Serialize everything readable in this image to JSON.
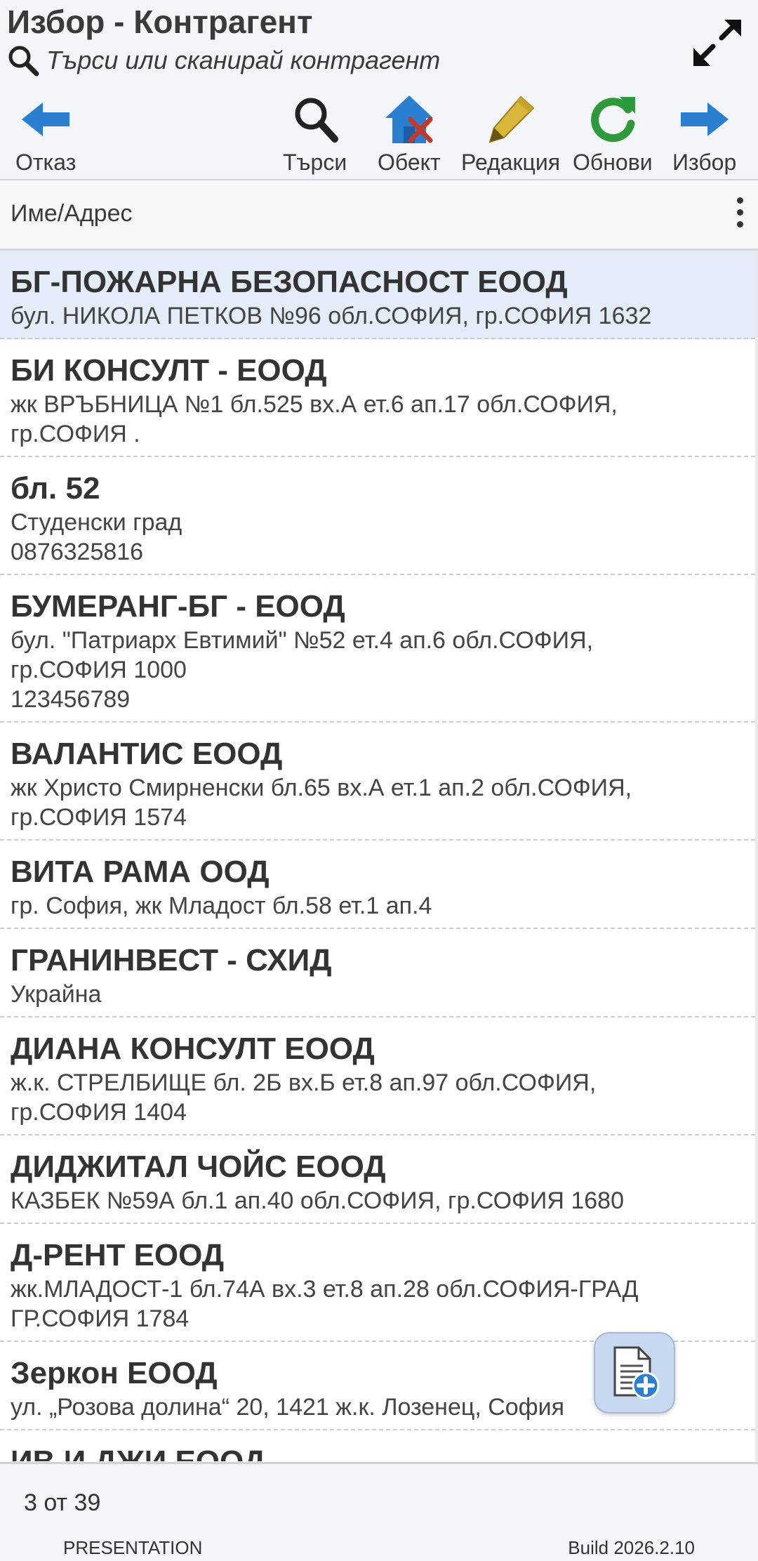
{
  "header": {
    "title": "Избор - Контрагент",
    "search_placeholder": "Търси или сканирай контрагент"
  },
  "toolbar": {
    "cancel": "Отказ",
    "search": "Търси",
    "object": "Обект",
    "edit": "Редакция",
    "refresh": "Обнови",
    "select": "Избор"
  },
  "list_header": {
    "column": "Име/Адрес"
  },
  "items": [
    {
      "name": "БГ-ПОЖАРНА БЕЗОПАСНОСТ ЕООД",
      "lines": [
        "бул. НИКОЛА ПЕТКОВ №96 обл.СОФИЯ, гр.СОФИЯ 1632"
      ]
    },
    {
      "name": "БИ КОНСУЛТ - ЕООД",
      "lines": [
        "жк ВРЪБНИЦА №1 бл.525 вх.А ет.6 ап.17 обл.СОФИЯ,",
        "гр.СОФИЯ ."
      ]
    },
    {
      "name": "бл. 52",
      "lines": [
        "Студенски град",
        "0876325816"
      ]
    },
    {
      "name": "БУМЕРАНГ-БГ - ЕООД",
      "lines": [
        "бул. \"Патриарх Евтимий\" №52 ет.4 ап.6 обл.СОФИЯ,",
        "гр.СОФИЯ 1000",
        "123456789"
      ]
    },
    {
      "name": "ВАЛАНТИС ЕООД",
      "lines": [
        "жк Христо Смирненски бл.65 вх.А ет.1 ап.2 обл.СОФИЯ,",
        "гр.СОФИЯ 1574"
      ]
    },
    {
      "name": "ВИТА РАМА ООД",
      "lines": [
        "гр. София, жк Младост бл.58 ет.1 ап.4"
      ]
    },
    {
      "name": "ГРАНИНВЕСТ - СХИД",
      "lines": [
        "Украйна"
      ]
    },
    {
      "name": "ДИАНА КОНСУЛТ ЕООД",
      "lines": [
        "ж.к. СТРЕЛБИЩЕ бл. 2Б вх.Б ет.8 ап.97 обл.СОФИЯ,",
        "гр.СОФИЯ 1404"
      ]
    },
    {
      "name": "ДИДЖИТАЛ ЧОЙС ЕООД",
      "lines": [
        "КАЗБЕК №59А бл.1 ап.40 обл.СОФИЯ, гр.СОФИЯ 1680"
      ]
    },
    {
      "name": "Д-РЕНТ ЕООД",
      "lines": [
        "жк.МЛАДОСТ-1 бл.74А вх.3 ет.8 ап.28 обл.СОФИЯ-ГРАД",
        "ГР.СОФИЯ 1784"
      ]
    },
    {
      "name": "Зеркон ЕООД",
      "lines": [
        "ул. „Розова долина“ 20, 1421 ж.к. Лозенец, София"
      ]
    },
    {
      "name": "ИВ И ДЖИ ЕООД",
      "lines": []
    }
  ],
  "footer": {
    "pager": "3 от 39",
    "mode": "PRESENTATION",
    "build": "Build 2026.2.10"
  },
  "colors": {
    "accent_blue": "#2a7fd0",
    "refresh_green": "#2f9a3c",
    "edit_gold": "#d9b73a",
    "selected_row": "#e4ecf8"
  }
}
